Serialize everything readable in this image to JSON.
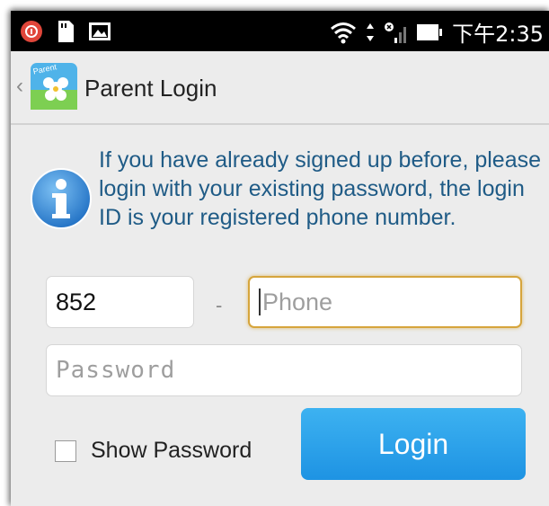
{
  "status_bar": {
    "time": "下午2:35",
    "icons": [
      "app-notification-icon",
      "sd-card-icon",
      "image-icon",
      "wifi-icon",
      "data-arrows-icon",
      "no-sim-signal-icon",
      "battery-icon"
    ]
  },
  "action_bar": {
    "back_glyph": "‹",
    "app_icon_text": "Parent",
    "title": "Parent Login"
  },
  "info": {
    "text": "If you have already signed up before, please login with your existing password, the login ID is your registered phone number."
  },
  "form": {
    "country_code": "852",
    "separator": "-",
    "phone_placeholder": "Phone",
    "password_placeholder": "Password",
    "show_password_label": "Show Password",
    "show_password_checked": false,
    "login_label": "Login"
  },
  "colors": {
    "info_text": "#1f5b86",
    "login_button": "#2aa3ec",
    "focus_border": "#d6a53c"
  }
}
